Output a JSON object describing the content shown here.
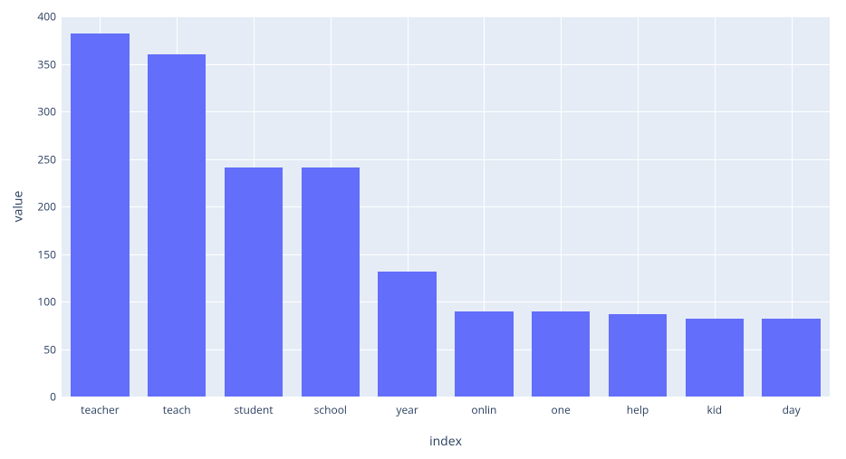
{
  "chart_data": {
    "type": "bar",
    "categories": [
      "teacher",
      "teach",
      "student",
      "school",
      "year",
      "onlin",
      "one",
      "help",
      "kid",
      "day"
    ],
    "values": [
      382,
      360,
      241,
      241,
      131,
      90,
      90,
      87,
      82,
      82
    ],
    "title": "",
    "xlabel": "index",
    "ylabel": "value",
    "ylim": [
      0,
      400
    ],
    "yticks": [
      0,
      50,
      100,
      150,
      200,
      250,
      300,
      350,
      400
    ],
    "bar_color": "#636efa",
    "bg_color": "#e5ecf6"
  }
}
